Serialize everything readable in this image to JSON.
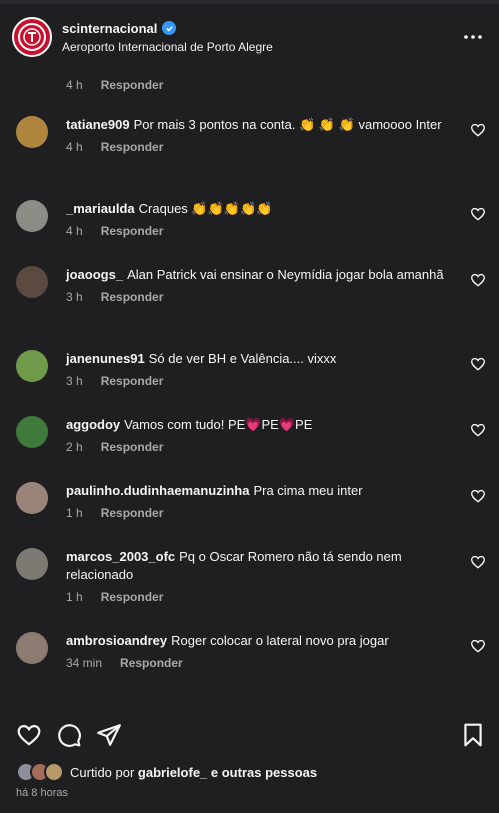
{
  "header": {
    "username": "scinternacional",
    "location": "Aeroporto Internacional de Porto Alegre"
  },
  "first_meta": {
    "time": "4 h",
    "reply": "Responder"
  },
  "comments": [
    {
      "user": "tatiane909",
      "text": "Por mais 3 pontos na conta. 👏 👏 👏 vamoooo Inter",
      "time": "4 h",
      "reply": "Responder",
      "avatar_color": "#b0863f"
    },
    {
      "user": "_mariaulda",
      "text": "Craques 👏👏👏👏👏",
      "time": "4 h",
      "reply": "Responder",
      "avatar_color": "#8a8d86"
    },
    {
      "user": "joaoogs_",
      "text": "Alan Patrick vai ensinar o Neymídia jogar bola amanhã",
      "time": "3 h",
      "reply": "Responder",
      "avatar_color": "#5a4a40"
    },
    {
      "user": "janenunes91",
      "text": "Só de ver BH e Valência.... vixxx",
      "time": "3 h",
      "reply": "Responder",
      "avatar_color": "#6f9a4a"
    },
    {
      "user": "aggodoy",
      "text": "Vamos com tudo! PE💗PE💗PE",
      "time": "2 h",
      "reply": "Responder",
      "avatar_color": "#3f7a3a"
    },
    {
      "user": "paulinho.dudinhaemanuzinha",
      "text": "Pra cima meu inter",
      "time": "1 h",
      "reply": "Responder",
      "avatar_color": "#9a8478"
    },
    {
      "user": "marcos_2003_ofc",
      "text": "Pq o Oscar Romero não tá sendo nem relacionado",
      "time": "1 h",
      "reply": "Responder",
      "avatar_color": "#7d7a74"
    },
    {
      "user": "ambrosioandrey",
      "text": "Roger colocar o lateral novo pra jogar",
      "time": "34 min",
      "reply": "Responder",
      "avatar_color": "#8c7b70"
    }
  ],
  "liked_by": {
    "prefix": "Curtido por ",
    "user": "gabrielofe_",
    "suffix": " e outras pessoas"
  },
  "time_ago": "há 8 horas",
  "colors": {
    "background": "#1f1f22",
    "verified": "#3897f0",
    "brand": "#c8102e",
    "muted": "#a8a8a8"
  }
}
